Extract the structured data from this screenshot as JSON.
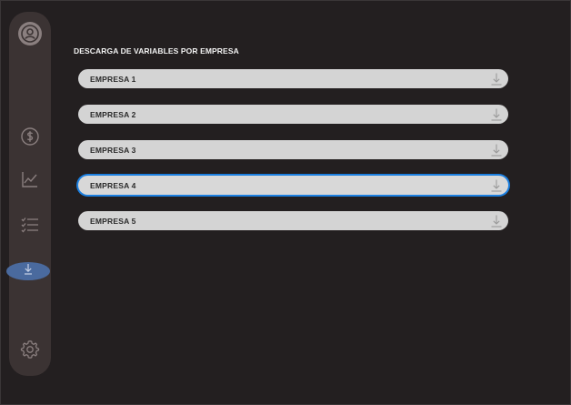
{
  "page": {
    "heading": "DESCARGA DE VARIABLES POR EMPRESA"
  },
  "sidebar": {
    "items": [
      {
        "name": "profile",
        "icon": "user-circle-icon",
        "active": false
      },
      {
        "name": "finance",
        "icon": "dollar-circle-icon",
        "active": false
      },
      {
        "name": "analytics",
        "icon": "line-chart-icon",
        "active": false
      },
      {
        "name": "checklist",
        "icon": "checklist-icon",
        "active": false
      },
      {
        "name": "download",
        "icon": "download-icon",
        "active": true
      },
      {
        "name": "settings",
        "icon": "gear-icon",
        "active": false
      }
    ]
  },
  "companies": [
    {
      "label": "EMPRESA 1",
      "icon": "download-icon",
      "focused": false
    },
    {
      "label": "EMPRESA 2",
      "icon": "download-icon",
      "focused": false
    },
    {
      "label": "EMPRESA 3",
      "icon": "download-icon",
      "focused": false
    },
    {
      "label": "EMPRESA 4",
      "icon": "download-icon",
      "focused": true
    },
    {
      "label": "EMPRESA 5",
      "icon": "download-icon",
      "focused": false
    }
  ],
  "colors": {
    "background": "#231f20",
    "sidebar": "#3b3333",
    "active_accent": "#4a6a9e",
    "focus_ring": "#1b7fe0",
    "row_fill": "#d4d4d4"
  }
}
